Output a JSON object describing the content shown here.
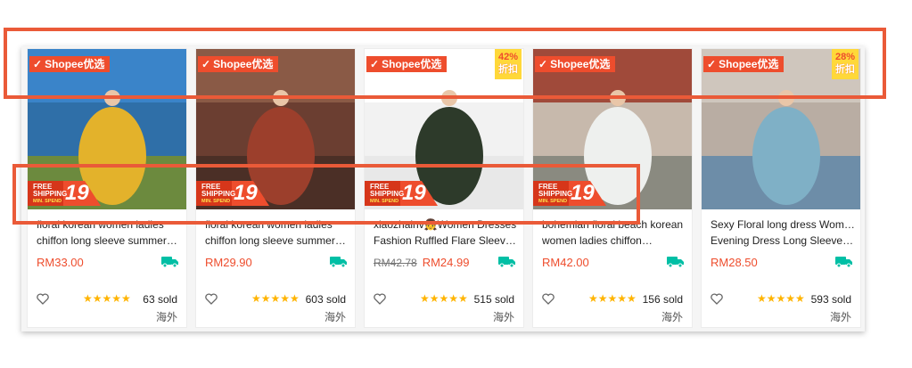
{
  "products": [
    {
      "badge": "Shopee优选",
      "discount": null,
      "free_shipping": {
        "line1": "FREE SHIPPING",
        "line2": "MIN. SPEND",
        "amount": "19"
      },
      "title_line1": "floral korean women ladies",
      "title_line2": "chiffon long sleeve summer…",
      "price_old": "",
      "price": "RM33.00",
      "rating": "★★★★★",
      "sold": "63 sold",
      "origin": "海外",
      "image_colors": {
        "sky": "#3a84c9",
        "sea": "#2f6fa8",
        "ground": "#6c8a3e",
        "dress": "#e3b22b"
      }
    },
    {
      "badge": "Shopee优选",
      "discount": null,
      "free_shipping": {
        "line1": "FREE SHIPPING",
        "line2": "MIN. SPEND",
        "amount": "19"
      },
      "title_line1": "floral korean women ladies",
      "title_line2": "chiffon long sleeve summer…",
      "price_old": "",
      "price": "RM29.90",
      "rating": "★★★★★",
      "sold": "603 sold",
      "origin": "海外",
      "image_colors": {
        "sky": "#8a5a46",
        "sea": "#6b3e31",
        "ground": "#4b2f26",
        "dress": "#9c3f2c"
      }
    },
    {
      "badge": "Shopee优选",
      "discount": {
        "percent": "42%",
        "label": "折扣"
      },
      "free_shipping": {
        "line1": "FREE SHIPPING",
        "line2": "MIN. SPEND",
        "amount": "19"
      },
      "title_line1": "xiaozhainv👧Women Dresses",
      "title_line2": "Fashion Ruffled Flare Sleeve…",
      "price_old": "RM42.78",
      "price": "RM24.99",
      "rating": "★★★★★",
      "sold": "515 sold",
      "origin": "海外",
      "image_colors": {
        "sky": "#ffffff",
        "sea": "#f2f2f2",
        "ground": "#e8e8e8",
        "dress": "#2d3a2a"
      }
    },
    {
      "badge": "Shopee优选",
      "discount": null,
      "free_shipping": {
        "line1": "FREE SHIPPING",
        "line2": "MIN. SPEND",
        "amount": "19"
      },
      "title_line1": "bohemian floral beach korean",
      "title_line2": "women ladies chiffon…",
      "price_old": "",
      "price": "RM42.00",
      "rating": "★★★★★",
      "sold": "156 sold",
      "origin": "海外",
      "image_colors": {
        "sky": "#a04a3a",
        "sea": "#c7b9ac",
        "ground": "#8a8a80",
        "dress": "#eef0ee"
      }
    },
    {
      "badge": "Shopee优选",
      "discount": {
        "percent": "28%",
        "label": "折扣"
      },
      "free_shipping": null,
      "title_line1": "Sexy Floral long dress Women",
      "title_line2": "Evening Dress Long Sleeve…",
      "price_old": "",
      "price": "RM28.50",
      "rating": "★★★★★",
      "sold": "593 sold",
      "origin": "海外",
      "image_colors": {
        "sky": "#cfc6bd",
        "sea": "#b9ada3",
        "ground": "#6d8da8",
        "dress": "#7fb0c6"
      }
    }
  ],
  "colors": {
    "accent": "#ee4d2d",
    "highlight_box": "#ea5a38",
    "star": "#ffb400"
  },
  "icons": {
    "badge_check": "check-icon",
    "like": "heart-icon",
    "shipping": "truck-icon"
  }
}
